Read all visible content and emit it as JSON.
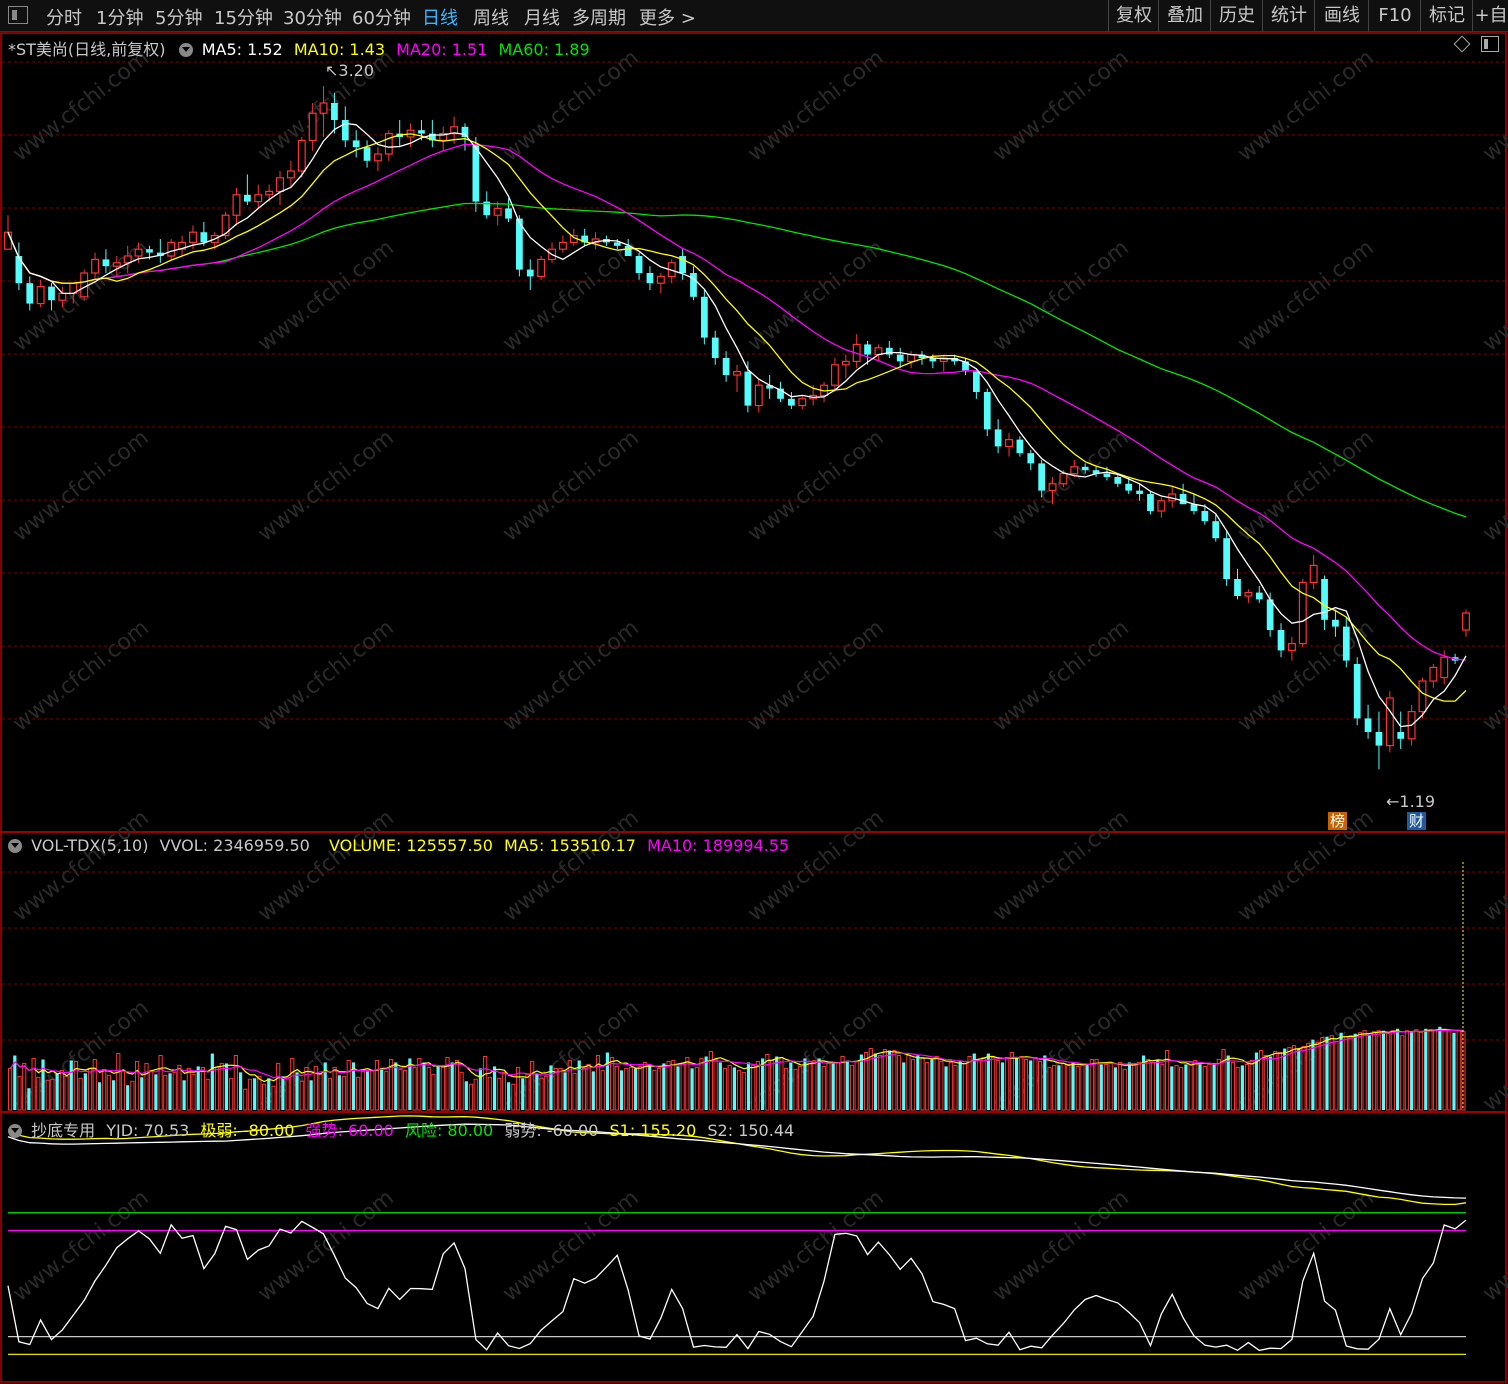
{
  "toolbar": {
    "periods": [
      "分时",
      "1分钟",
      "5分钟",
      "15分钟",
      "30分钟",
      "60分钟",
      "日线",
      "周线",
      "月线",
      "多周期",
      "更多 >"
    ],
    "active_period": "日线",
    "right_buttons": [
      "复权",
      "叠加",
      "历史",
      "统计",
      "画线",
      "F10",
      "标记",
      "+自"
    ]
  },
  "main_header": {
    "title": "*ST美尚(日线,前复权)",
    "ma5": "MA5: 1.52",
    "ma10": "MA10: 1.43",
    "ma20": "MA20: 1.51",
    "ma60": "MA60: 1.89"
  },
  "annotations": {
    "high": "3.20",
    "low": "1.19",
    "badge1": "榜",
    "badge2": "财"
  },
  "vol_header": {
    "name": "VOL-TDX(5,10)",
    "vvol": "VVOL: 2346959.50",
    "volume": "VOLUME: 125557.50",
    "ma5": "MA5: 153510.17",
    "ma10": "MA10: 189994.55"
  },
  "ind_header": {
    "name": "抄底专用",
    "yjd": "YJD: 70.53",
    "jiruo": "极弱: -80.00",
    "qiangshi": "强势: 60.00",
    "fengxian": "风险: 80.00",
    "ruoshi": "弱势: -60.00",
    "s1": "S1: 155.20",
    "s2": "S2: 150.44"
  },
  "watermark": "www.cfchi.com",
  "colors": {
    "up": "#ff3232",
    "down": "#54fcfc",
    "ma5": "#ffffff",
    "ma10": "#ffff00",
    "ma20": "#ff00ff",
    "ma60": "#00e600",
    "grid": "#7a0000",
    "border": "#b40000"
  },
  "chart_data": [
    {
      "type": "candlestick",
      "title": "*ST美尚(日线,前复权)",
      "ylim": [
        1.1,
        3.3
      ],
      "marked_high": 3.2,
      "marked_low": 1.19,
      "ohlc": [
        [
          2.72,
          2.82,
          2.72,
          2.77
        ],
        [
          2.7,
          2.74,
          2.6,
          2.62
        ],
        [
          2.62,
          2.64,
          2.54,
          2.56
        ],
        [
          2.56,
          2.63,
          2.55,
          2.61
        ],
        [
          2.61,
          2.62,
          2.54,
          2.57
        ],
        [
          2.57,
          2.61,
          2.55,
          2.59
        ],
        [
          2.59,
          2.62,
          2.56,
          2.62
        ],
        [
          2.58,
          2.66,
          2.57,
          2.65
        ],
        [
          2.65,
          2.71,
          2.63,
          2.69
        ],
        [
          2.69,
          2.72,
          2.65,
          2.67
        ],
        [
          2.67,
          2.7,
          2.64,
          2.68
        ],
        [
          2.68,
          2.73,
          2.65,
          2.7
        ],
        [
          2.7,
          2.74,
          2.68,
          2.72
        ],
        [
          2.72,
          2.73,
          2.69,
          2.71
        ],
        [
          2.71,
          2.75,
          2.68,
          2.7
        ],
        [
          2.7,
          2.75,
          2.69,
          2.74
        ],
        [
          2.72,
          2.76,
          2.7,
          2.74
        ],
        [
          2.74,
          2.79,
          2.72,
          2.77
        ],
        [
          2.77,
          2.8,
          2.73,
          2.74
        ],
        [
          2.74,
          2.77,
          2.72,
          2.76
        ],
        [
          2.76,
          2.83,
          2.75,
          2.82
        ],
        [
          2.82,
          2.9,
          2.79,
          2.88
        ],
        [
          2.88,
          2.94,
          2.85,
          2.86
        ],
        [
          2.86,
          2.91,
          2.84,
          2.88
        ],
        [
          2.88,
          2.91,
          2.86,
          2.89
        ],
        [
          2.89,
          2.95,
          2.85,
          2.93
        ],
        [
          2.93,
          2.98,
          2.9,
          2.95
        ],
        [
          2.95,
          3.05,
          2.93,
          3.04
        ],
        [
          3.04,
          3.15,
          3.01,
          3.12
        ],
        [
          3.12,
          3.2,
          3.05,
          3.15
        ],
        [
          3.15,
          3.18,
          3.06,
          3.1
        ],
        [
          3.1,
          3.14,
          3.02,
          3.04
        ],
        [
          3.04,
          3.07,
          2.99,
          3.02
        ],
        [
          3.02,
          3.04,
          2.96,
          2.98
        ],
        [
          2.98,
          3.02,
          2.95,
          3.0
        ],
        [
          3.0,
          3.07,
          2.98,
          3.06
        ],
        [
          3.06,
          3.1,
          3.02,
          3.05
        ],
        [
          3.05,
          3.09,
          3.02,
          3.07
        ],
        [
          3.07,
          3.1,
          3.04,
          3.06
        ],
        [
          3.06,
          3.1,
          3.02,
          3.04
        ],
        [
          3.04,
          3.08,
          3.01,
          3.06
        ],
        [
          3.06,
          3.11,
          3.03,
          3.08
        ],
        [
          3.08,
          3.09,
          3.01,
          3.05
        ],
        [
          3.03,
          3.05,
          2.83,
          2.86
        ],
        [
          2.86,
          2.89,
          2.81,
          2.82
        ],
        [
          2.82,
          2.86,
          2.79,
          2.84
        ],
        [
          2.84,
          2.87,
          2.8,
          2.81
        ],
        [
          2.81,
          2.82,
          2.64,
          2.66
        ],
        [
          2.66,
          2.69,
          2.6,
          2.64
        ],
        [
          2.64,
          2.7,
          2.63,
          2.69
        ],
        [
          2.69,
          2.74,
          2.68,
          2.72
        ],
        [
          2.72,
          2.76,
          2.71,
          2.74
        ],
        [
          2.74,
          2.78,
          2.73,
          2.76
        ],
        [
          2.76,
          2.78,
          2.73,
          2.74
        ],
        [
          2.74,
          2.77,
          2.72,
          2.75
        ],
        [
          2.75,
          2.76,
          2.73,
          2.74
        ],
        [
          2.74,
          2.75,
          2.72,
          2.73
        ],
        [
          2.73,
          2.75,
          2.7,
          2.7
        ],
        [
          2.7,
          2.71,
          2.63,
          2.65
        ],
        [
          2.65,
          2.67,
          2.6,
          2.62
        ],
        [
          2.62,
          2.65,
          2.59,
          2.64
        ],
        [
          2.64,
          2.69,
          2.62,
          2.68
        ],
        [
          2.7,
          2.72,
          2.63,
          2.65
        ],
        [
          2.65,
          2.67,
          2.57,
          2.58
        ],
        [
          2.58,
          2.6,
          2.44,
          2.46
        ],
        [
          2.46,
          2.48,
          2.38,
          2.4
        ],
        [
          2.4,
          2.42,
          2.33,
          2.35
        ],
        [
          2.35,
          2.38,
          2.3,
          2.36
        ],
        [
          2.36,
          2.39,
          2.24,
          2.26
        ],
        [
          2.26,
          2.34,
          2.24,
          2.32
        ],
        [
          2.32,
          2.35,
          2.28,
          2.31
        ],
        [
          2.31,
          2.33,
          2.27,
          2.28
        ],
        [
          2.28,
          2.3,
          2.25,
          2.26
        ],
        [
          2.26,
          2.29,
          2.25,
          2.28
        ],
        [
          2.28,
          2.32,
          2.26,
          2.29
        ],
        [
          2.29,
          2.33,
          2.27,
          2.32
        ],
        [
          2.32,
          2.4,
          2.3,
          2.38
        ],
        [
          2.38,
          2.41,
          2.34,
          2.39
        ],
        [
          2.39,
          2.47,
          2.37,
          2.44
        ],
        [
          2.44,
          2.45,
          2.38,
          2.41
        ],
        [
          2.41,
          2.44,
          2.39,
          2.43
        ],
        [
          2.43,
          2.45,
          2.4,
          2.41
        ],
        [
          2.41,
          2.43,
          2.37,
          2.39
        ],
        [
          2.39,
          2.42,
          2.37,
          2.41
        ],
        [
          2.41,
          2.42,
          2.38,
          2.4
        ],
        [
          2.4,
          2.41,
          2.37,
          2.39
        ],
        [
          2.39,
          2.41,
          2.36,
          2.4
        ],
        [
          2.4,
          2.41,
          2.38,
          2.39
        ],
        [
          2.39,
          2.4,
          2.35,
          2.36
        ],
        [
          2.36,
          2.37,
          2.28,
          2.3
        ],
        [
          2.3,
          2.31,
          2.17,
          2.19
        ],
        [
          2.19,
          2.22,
          2.12,
          2.14
        ],
        [
          2.14,
          2.18,
          2.11,
          2.16
        ],
        [
          2.16,
          2.17,
          2.11,
          2.12
        ],
        [
          2.12,
          2.13,
          2.07,
          2.09
        ],
        [
          2.09,
          2.1,
          1.99,
          2.01
        ],
        [
          2.01,
          2.05,
          1.97,
          2.03
        ],
        [
          2.03,
          2.07,
          2.02,
          2.06
        ],
        [
          2.06,
          2.1,
          2.05,
          2.08
        ],
        [
          2.08,
          2.09,
          2.06,
          2.07
        ],
        [
          2.07,
          2.08,
          2.05,
          2.06
        ],
        [
          2.06,
          2.08,
          2.04,
          2.05
        ],
        [
          2.05,
          2.06,
          2.02,
          2.03
        ],
        [
          2.03,
          2.05,
          2.0,
          2.01
        ],
        [
          2.01,
          2.03,
          1.98,
          2.0
        ],
        [
          2.0,
          2.01,
          1.94,
          1.95
        ],
        [
          1.95,
          1.99,
          1.93,
          1.98
        ],
        [
          1.98,
          2.02,
          1.96,
          2.0
        ],
        [
          2.0,
          2.03,
          1.98,
          1.97
        ],
        [
          1.97,
          2.0,
          1.94,
          1.95
        ],
        [
          1.95,
          1.97,
          1.91,
          1.92
        ],
        [
          1.92,
          1.94,
          1.86,
          1.87
        ],
        [
          1.87,
          1.89,
          1.73,
          1.75
        ],
        [
          1.75,
          1.78,
          1.69,
          1.7
        ],
        [
          1.7,
          1.72,
          1.68,
          1.71
        ],
        [
          1.71,
          1.73,
          1.68,
          1.69
        ],
        [
          1.69,
          1.71,
          1.58,
          1.6
        ],
        [
          1.6,
          1.62,
          1.52,
          1.54
        ],
        [
          1.54,
          1.58,
          1.51,
          1.56
        ],
        [
          1.56,
          1.75,
          1.55,
          1.74
        ],
        [
          1.74,
          1.82,
          1.72,
          1.79
        ],
        [
          1.75,
          1.76,
          1.6,
          1.63
        ],
        [
          1.63,
          1.66,
          1.58,
          1.61
        ],
        [
          1.61,
          1.64,
          1.49,
          1.51
        ],
        [
          1.5,
          1.52,
          1.32,
          1.34
        ],
        [
          1.34,
          1.38,
          1.28,
          1.3
        ],
        [
          1.3,
          1.36,
          1.19,
          1.26
        ],
        [
          1.26,
          1.42,
          1.24,
          1.4
        ],
        [
          1.3,
          1.36,
          1.25,
          1.28
        ],
        [
          1.28,
          1.38,
          1.26,
          1.36
        ],
        [
          1.36,
          1.46,
          1.34,
          1.45
        ],
        [
          1.45,
          1.5,
          1.43,
          1.49
        ],
        [
          1.46,
          1.54,
          1.44,
          1.52
        ],
        [
          1.52,
          1.53,
          1.5,
          1.51
        ],
        [
          1.6,
          1.66,
          1.58,
          1.65
        ]
      ]
    },
    {
      "type": "bar",
      "title": "VOL-TDX(5,10)",
      "series": [
        {
          "name": "VOLUME",
          "values": [
            42,
            55,
            34,
            47,
            22,
            52,
            33,
            51,
            30,
            31,
            37,
            40,
            34,
            50,
            49,
            32,
            37,
            42,
            51,
            28,
            41,
            35,
            30,
            57,
            40,
            25,
            29,
            49,
            33,
            47,
            40,
            36,
            55,
            35,
            37,
            38,
            45,
            30,
            42,
            36,
            44,
            43,
            31,
            57,
            43,
            47,
            47,
            32,
            55,
            38,
            21,
            31,
            32,
            34,
            26,
            32,
            24,
            47,
            34,
            33,
            52,
            38,
            29,
            43,
            30,
            44,
            36,
            48,
            32,
            43,
            35,
            34,
            50,
            48,
            33,
            39,
            39,
            40,
            50,
            42,
            39,
            51,
            48,
            41,
            40,
            52,
            43,
            52,
            48,
            43,
            36,
            45,
            45,
            53,
            48,
            50,
            38,
            29,
            26,
            31,
            42,
            54,
            33,
            44,
            32,
            38,
            28,
            26,
            43,
            32,
            36,
            49,
            37,
            32,
            34,
            45,
            42,
            42,
            38,
            50,
            37,
            50,
            42,
            46,
            39,
            55,
            40,
            58,
            53,
            44,
            40,
            42,
            43,
            42,
            44,
            48,
            46,
            40,
            42,
            47,
            49,
            50,
            44,
            47,
            53,
            42,
            43,
            52,
            54,
            59,
            51,
            48,
            42,
            45,
            43,
            40,
            38,
            48,
            45,
            49,
            52,
            56,
            50,
            54,
            53,
            42,
            48,
            41,
            44,
            52,
            49,
            50,
            52,
            44,
            47,
            47,
            48,
            54,
            50,
            45,
            49,
            56,
            58,
            62,
            57,
            55,
            61,
            60,
            60,
            55,
            48,
            55,
            51,
            55,
            53,
            48,
            51,
            54,
            49,
            44,
            48,
            45,
            49,
            47,
            54,
            57,
            50,
            53,
            57,
            53,
            50,
            48,
            53,
            58,
            53,
            54,
            51,
            50,
            53,
            49,
            55,
            43,
            45,
            45,
            47,
            46,
            48,
            44,
            45,
            45,
            51,
            51,
            46,
            46,
            47,
            43,
            48,
            41,
            48,
            47,
            48,
            55,
            51,
            48,
            51,
            46,
            60,
            44,
            45,
            43,
            46,
            49,
            50,
            46,
            44,
            46,
            47,
            51,
            61,
            55,
            48,
            43,
            45,
            46,
            50,
            58,
            60,
            55,
            54,
            59,
            58,
            62,
            63,
            65,
            62,
            64,
            67,
            71,
            68,
            73,
            74,
            75,
            69,
            78,
            74,
            75,
            77,
            78,
            80,
            76,
            79,
            80,
            80,
            77,
            80,
            82,
            75,
            80,
            79,
            81,
            79,
            82,
            81,
            80,
            84,
            80,
            80,
            78,
            80,
            79
          ]
        }
      ]
    },
    {
      "type": "line",
      "title": "抄底专用",
      "series": [
        {
          "name": "YJD",
          "values": [
            70.53
          ]
        },
        {
          "name": "S1",
          "values": [
            155.2
          ]
        },
        {
          "name": "S2",
          "values": [
            150.44
          ]
        }
      ],
      "reference_levels": {
        "极弱": -80.0,
        "强势": 60.0,
        "风险": 80.0,
        "弱势": -60.0
      }
    }
  ]
}
